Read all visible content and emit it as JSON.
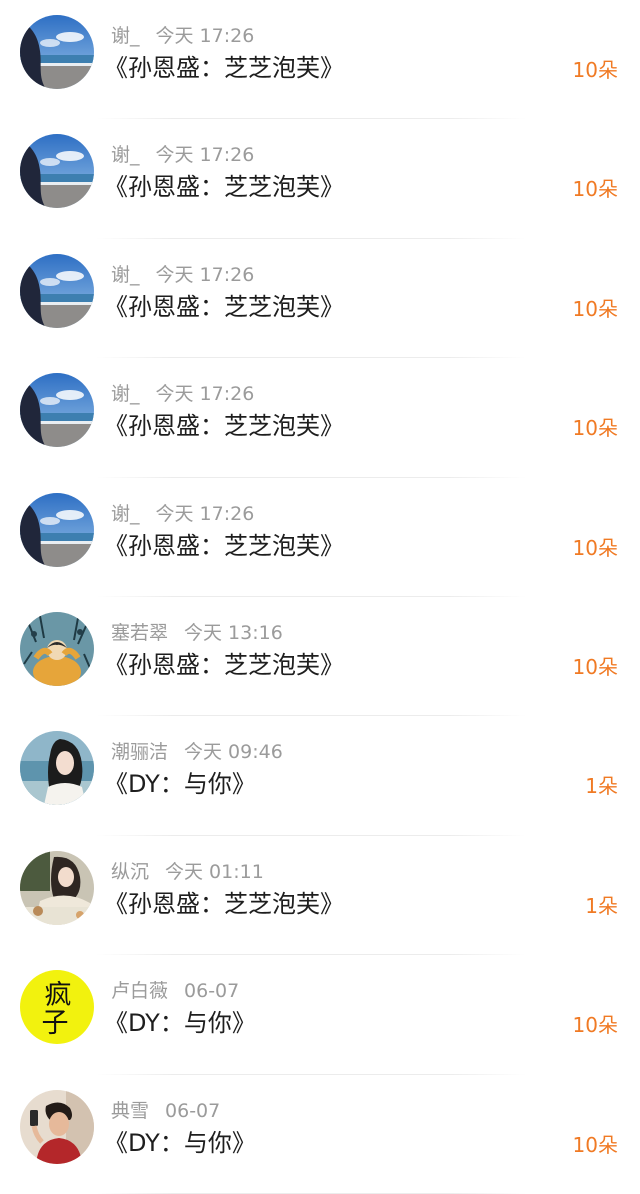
{
  "items": [
    {
      "user": "谢_",
      "time": "今天 17:26",
      "title": "《孙恩盛：芝芝泡芙》",
      "count": "10朵",
      "avatar": "beach-icon"
    },
    {
      "user": "谢_",
      "time": "今天 17:26",
      "title": "《孙恩盛：芝芝泡芙》",
      "count": "10朵",
      "avatar": "beach-icon"
    },
    {
      "user": "谢_",
      "time": "今天 17:26",
      "title": "《孙恩盛：芝芝泡芙》",
      "count": "10朵",
      "avatar": "beach-icon"
    },
    {
      "user": "谢_",
      "time": "今天 17:26",
      "title": "《孙恩盛：芝芝泡芙》",
      "count": "10朵",
      "avatar": "beach-icon"
    },
    {
      "user": "谢_",
      "time": "今天 17:26",
      "title": "《孙恩盛：芝芝泡芙》",
      "count": "10朵",
      "avatar": "beach-icon"
    },
    {
      "user": "塞若翠",
      "time": "今天 13:16",
      "title": "《孙恩盛：芝芝泡芙》",
      "count": "10朵",
      "avatar": "illustration-icon"
    },
    {
      "user": "潮骊洁",
      "time": "今天 09:46",
      "title": "《DY：与你》",
      "count": "1朵",
      "avatar": "seaside-girl-icon"
    },
    {
      "user": "纵沉",
      "time": "今天 01:11",
      "title": "《孙恩盛：芝芝泡芙》",
      "count": "1朵",
      "avatar": "table-girl-icon"
    },
    {
      "user": "卢白薇",
      "time": "06-07",
      "title": "《DY：与你》",
      "count": "10朵",
      "avatar": "yellow-text-icon",
      "avatar_text": "疯子"
    },
    {
      "user": "典雪",
      "time": "06-07",
      "title": "《DY：与你》",
      "count": "10朵",
      "avatar": "boy-selfie-icon"
    }
  ]
}
